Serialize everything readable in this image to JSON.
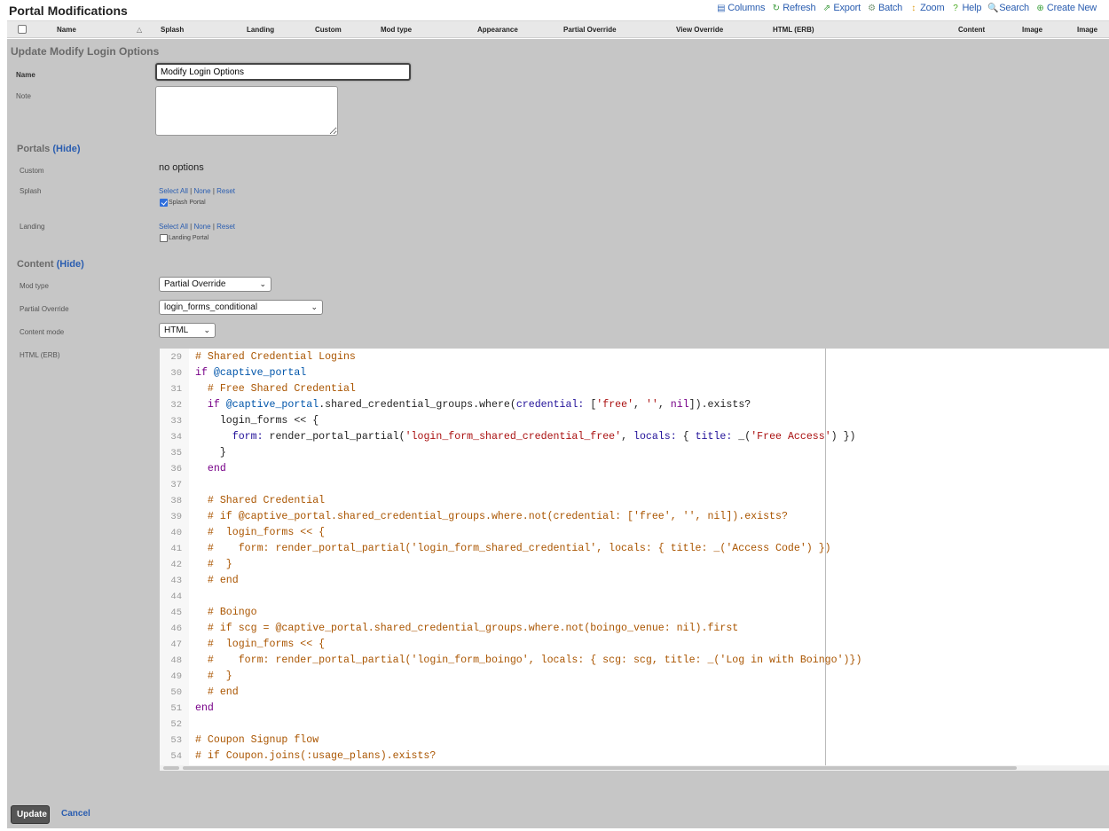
{
  "page_title": "Portal Modifications",
  "toolbar": [
    {
      "label": "Columns",
      "icon": "columns-icon",
      "glyph": "▤",
      "color": "#3a6bb8"
    },
    {
      "label": "Refresh",
      "icon": "refresh-icon",
      "glyph": "↻",
      "color": "#3a9a3a"
    },
    {
      "label": "Export",
      "icon": "export-icon",
      "glyph": "⇗",
      "color": "#3a9a3a"
    },
    {
      "label": "Batch",
      "icon": "batch-icon",
      "glyph": "⚙",
      "color": "#7a9a7a"
    },
    {
      "label": "Zoom",
      "icon": "zoom-icon",
      "glyph": "↕",
      "color": "#e0a020"
    },
    {
      "label": "Help",
      "icon": "help-icon",
      "glyph": "?",
      "color": "#4aaa20"
    },
    {
      "label": "Search",
      "icon": "search-icon",
      "glyph": "🔍",
      "color": "#6a8ab8"
    },
    {
      "label": "Create New",
      "icon": "create-new-icon",
      "glyph": "⊕",
      "color": "#3aa03a"
    }
  ],
  "columns": [
    "Name",
    "Splash",
    "Landing",
    "Custom",
    "Mod type",
    "Appearance",
    "Partial Override",
    "View Override",
    "HTML (ERB)",
    "Content",
    "Image",
    "Image"
  ],
  "form": {
    "title": "Update Modify Login Options",
    "name_label": "Name",
    "name_value": "Modify Login Options",
    "note_label": "Note",
    "note_value": "",
    "portals_section": "Portals",
    "hide_label": "(Hide)",
    "custom_label": "Custom",
    "custom_value": "no options",
    "splash_label": "Splash",
    "landing_label": "Landing",
    "select_all": "Select All",
    "none": "None",
    "reset": "Reset",
    "splash_portal_label": "Splash Portal",
    "splash_portal_checked": true,
    "landing_portal_label": "Landing Portal",
    "landing_portal_checked": false,
    "content_section": "Content",
    "mod_type_label": "Mod type",
    "mod_type_value": "Partial Override",
    "partial_override_label": "Partial Override",
    "partial_override_value": "login_forms_conditional",
    "content_mode_label": "Content mode",
    "content_mode_value": "HTML",
    "html_erb_label": "HTML (ERB)",
    "update_label": "Update",
    "cancel_label": "Cancel"
  },
  "code_lines": [
    {
      "num": "29",
      "tokens": [
        [
          "# Shared Credential Logins",
          "c-cmt"
        ]
      ]
    },
    {
      "num": "30",
      "tokens": [
        [
          "if",
          "c-kw"
        ],
        [
          " ",
          ""
        ],
        [
          "@captive_portal",
          "c-var"
        ]
      ]
    },
    {
      "num": "31",
      "tokens": [
        [
          "  # Free Shared Credential",
          "c-cmt"
        ]
      ]
    },
    {
      "num": "32",
      "tokens": [
        [
          "  ",
          ""
        ],
        [
          "if",
          "c-kw"
        ],
        [
          " ",
          ""
        ],
        [
          "@captive_portal",
          "c-var"
        ],
        [
          ".shared_credential_groups.where(",
          ""
        ],
        [
          "credential:",
          "c-sym"
        ],
        [
          " [",
          ""
        ],
        [
          "'free'",
          "c-str"
        ],
        [
          ", ",
          ""
        ],
        [
          "''",
          "c-str"
        ],
        [
          ", ",
          ""
        ],
        [
          "nil",
          "c-kw"
        ],
        [
          "]).exists?",
          ""
        ]
      ]
    },
    {
      "num": "33",
      "tokens": [
        [
          "    login_forms << {",
          ""
        ]
      ]
    },
    {
      "num": "34",
      "tokens": [
        [
          "      ",
          ""
        ],
        [
          "form:",
          "c-sym"
        ],
        [
          " render_portal_partial(",
          ""
        ],
        [
          "'login_form_shared_credential_free'",
          "c-str"
        ],
        [
          ", ",
          ""
        ],
        [
          "locals:",
          "c-sym"
        ],
        [
          " { ",
          ""
        ],
        [
          "title:",
          "c-sym"
        ],
        [
          " _(",
          ""
        ],
        [
          "'Free Access'",
          "c-str"
        ],
        [
          ") })",
          ""
        ]
      ]
    },
    {
      "num": "35",
      "tokens": [
        [
          "    }",
          ""
        ]
      ]
    },
    {
      "num": "36",
      "tokens": [
        [
          "  ",
          ""
        ],
        [
          "end",
          "c-kw"
        ]
      ]
    },
    {
      "num": "37",
      "tokens": []
    },
    {
      "num": "38",
      "tokens": [
        [
          "  # Shared Credential",
          "c-cmt"
        ]
      ]
    },
    {
      "num": "39",
      "tokens": [
        [
          "  # if @captive_portal.shared_credential_groups.where.not(credential: ['free', '', nil]).exists?",
          "c-cmt"
        ]
      ]
    },
    {
      "num": "40",
      "tokens": [
        [
          "  #  login_forms << {",
          "c-cmt"
        ]
      ]
    },
    {
      "num": "41",
      "tokens": [
        [
          "  #    form: render_portal_partial('login_form_shared_credential', locals: { title: _('Access Code') })",
          "c-cmt"
        ]
      ]
    },
    {
      "num": "42",
      "tokens": [
        [
          "  #  }",
          "c-cmt"
        ]
      ]
    },
    {
      "num": "43",
      "tokens": [
        [
          "  # end",
          "c-cmt"
        ]
      ]
    },
    {
      "num": "44",
      "tokens": []
    },
    {
      "num": "45",
      "tokens": [
        [
          "  # Boingo",
          "c-cmt"
        ]
      ]
    },
    {
      "num": "46",
      "tokens": [
        [
          "  # if scg = @captive_portal.shared_credential_groups.where.not(boingo_venue: nil).first",
          "c-cmt"
        ]
      ]
    },
    {
      "num": "47",
      "tokens": [
        [
          "  #  login_forms << {",
          "c-cmt"
        ]
      ]
    },
    {
      "num": "48",
      "tokens": [
        [
          "  #    form: render_portal_partial('login_form_boingo', locals: { scg: scg, title: _('Log in with Boingo')})",
          "c-cmt"
        ]
      ]
    },
    {
      "num": "49",
      "tokens": [
        [
          "  #  }",
          "c-cmt"
        ]
      ]
    },
    {
      "num": "50",
      "tokens": [
        [
          "  # end",
          "c-cmt"
        ]
      ]
    },
    {
      "num": "51",
      "tokens": [
        [
          "end",
          "c-kw"
        ]
      ]
    },
    {
      "num": "52",
      "tokens": []
    },
    {
      "num": "53",
      "tokens": [
        [
          "# Coupon Signup flow",
          "c-cmt"
        ]
      ]
    },
    {
      "num": "54",
      "tokens": [
        [
          "# if Coupon.joins(:usage_plans).exists?",
          "c-cmt"
        ]
      ]
    }
  ]
}
